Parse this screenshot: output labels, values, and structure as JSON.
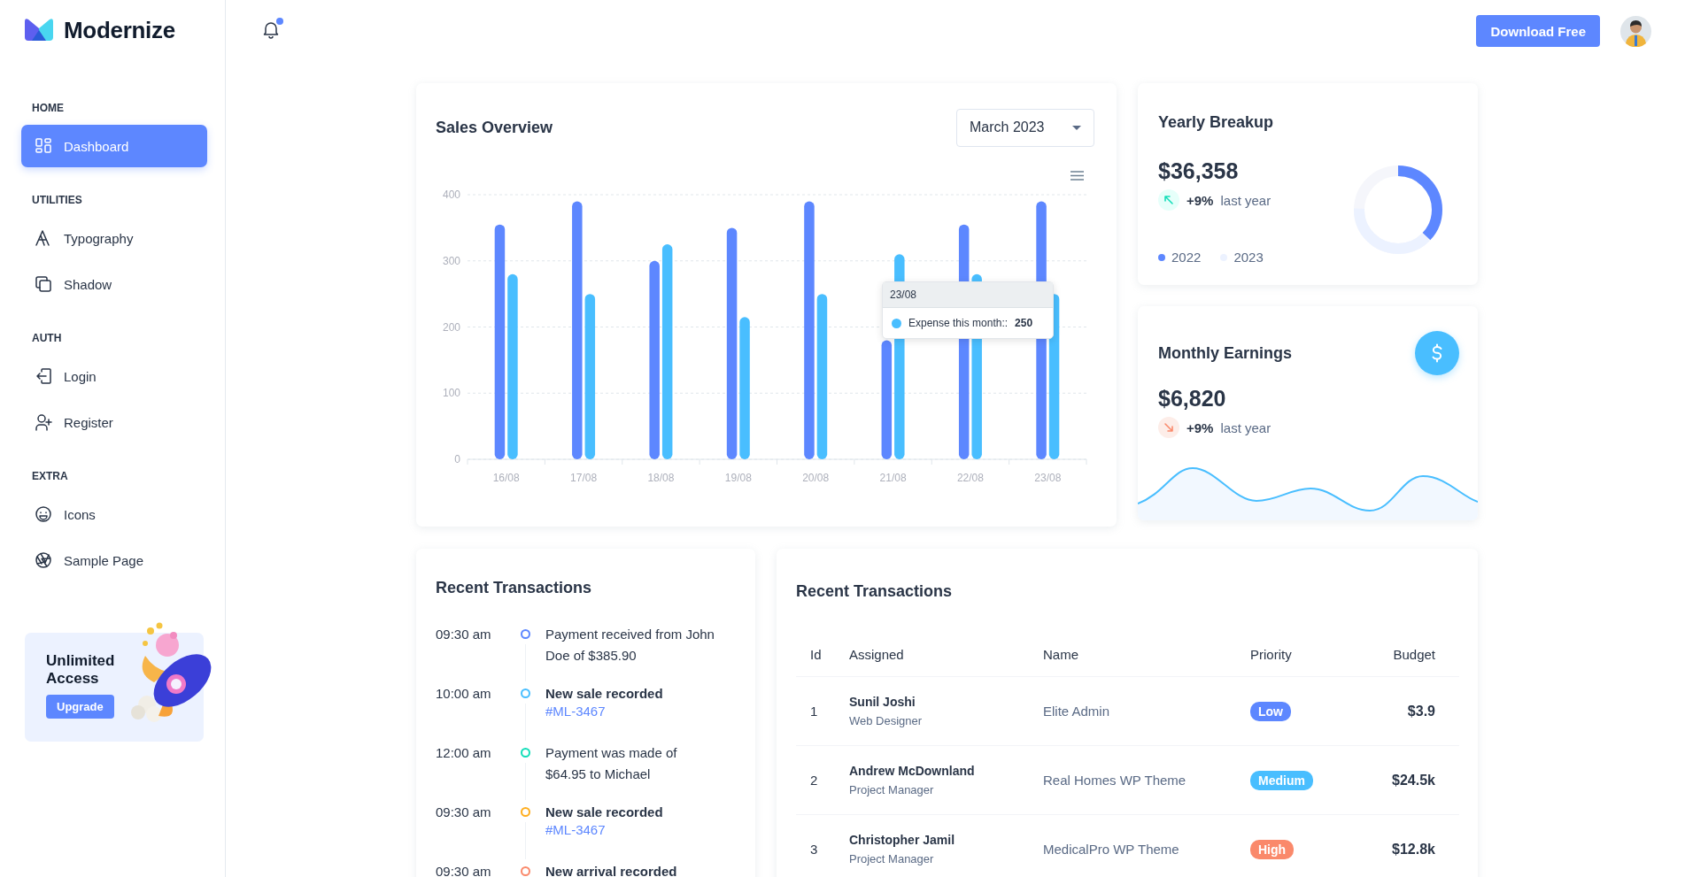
{
  "brand": {
    "name": "Modernize"
  },
  "sidebar": {
    "sections": [
      {
        "title": "HOME",
        "items": [
          {
            "label": "Dashboard",
            "selected": true
          }
        ]
      },
      {
        "title": "UTILITIES",
        "items": [
          {
            "label": "Typography",
            "selected": false
          },
          {
            "label": "Shadow",
            "selected": false
          }
        ]
      },
      {
        "title": "AUTH",
        "items": [
          {
            "label": "Login",
            "selected": false
          },
          {
            "label": "Register",
            "selected": false
          }
        ]
      },
      {
        "title": "EXTRA",
        "items": [
          {
            "label": "Icons",
            "selected": false
          },
          {
            "label": "Sample Page",
            "selected": false
          }
        ]
      }
    ],
    "promo": {
      "title": "Unlimited Access",
      "button": "Upgrade"
    }
  },
  "topbar": {
    "notification_unread": true,
    "button": "Download Free"
  },
  "sales_overview": {
    "title": "Sales Overview",
    "period": "March 2023",
    "chart_data": {
      "type": "bar",
      "categories": [
        "16/08",
        "17/08",
        "18/08",
        "19/08",
        "20/08",
        "21/08",
        "22/08",
        "23/08"
      ],
      "series": [
        {
          "color": "#5d87ff",
          "values": [
            355,
            390,
            300,
            350,
            390,
            180,
            355,
            390
          ]
        },
        {
          "color": "#49beff",
          "values": [
            280,
            250,
            325,
            215,
            250,
            310,
            280,
            250
          ]
        }
      ],
      "ylim": [
        0,
        400
      ],
      "yticks": [
        0,
        100,
        200,
        300,
        400
      ],
      "grid": true
    },
    "tooltip": {
      "title": "23/08",
      "label": "Expense this month::",
      "value": "250",
      "color": "#49beff"
    }
  },
  "yearly_breakup": {
    "title": "Yearly Breakup",
    "amount": "$36,358",
    "kind": "up",
    "change": "+9%",
    "period": "last year",
    "legend": [
      {
        "label": "2022",
        "color": "#5d87ff"
      },
      {
        "label": "2023",
        "color": "#ecf2ff"
      }
    ]
  },
  "monthly_earnings": {
    "title": "Monthly Earnings",
    "amount": "$6,820",
    "kind": "down",
    "change": "+9%",
    "period": "last year"
  },
  "timeline": {
    "title": "Recent Transactions",
    "items": [
      {
        "time": "09:30 am",
        "color": "#5d87ff",
        "kind": "note",
        "text": "Payment received from John Doe of $385.90"
      },
      {
        "time": "10:00 am",
        "color": "#49beff",
        "kind": "sale",
        "text": "New sale recorded",
        "link": "#ML-3467"
      },
      {
        "time": "12:00 am",
        "color": "#13deb9",
        "kind": "note",
        "text": "Payment was made of $64.95 to Michael"
      },
      {
        "time": "09:30 am",
        "color": "#ffae1f",
        "kind": "sale",
        "text": "New sale recorded",
        "link": "#ML-3467"
      },
      {
        "time": "09:30 am",
        "color": "#fa896b",
        "kind": "sale",
        "text": "New arrival recorded"
      }
    ]
  },
  "transactions_table": {
    "title": "Recent Transactions",
    "columns": [
      "Id",
      "Assigned",
      "Name",
      "Priority",
      "Budget"
    ],
    "rows": [
      {
        "id": "1",
        "assigned": "Sunil Joshi",
        "role": "Web Designer",
        "name": "Elite Admin",
        "priority": "Low",
        "color": "#5d87ff",
        "budget": "$3.9"
      },
      {
        "id": "2",
        "assigned": "Andrew McDownland",
        "role": "Project Manager",
        "name": "Real Homes WP Theme",
        "priority": "Medium",
        "color": "#49beff",
        "budget": "$24.5k"
      },
      {
        "id": "3",
        "assigned": "Christopher Jamil",
        "role": "Project Manager",
        "name": "MedicalPro WP Theme",
        "priority": "High",
        "color": "#fa896b",
        "budget": "$12.8k"
      }
    ]
  }
}
